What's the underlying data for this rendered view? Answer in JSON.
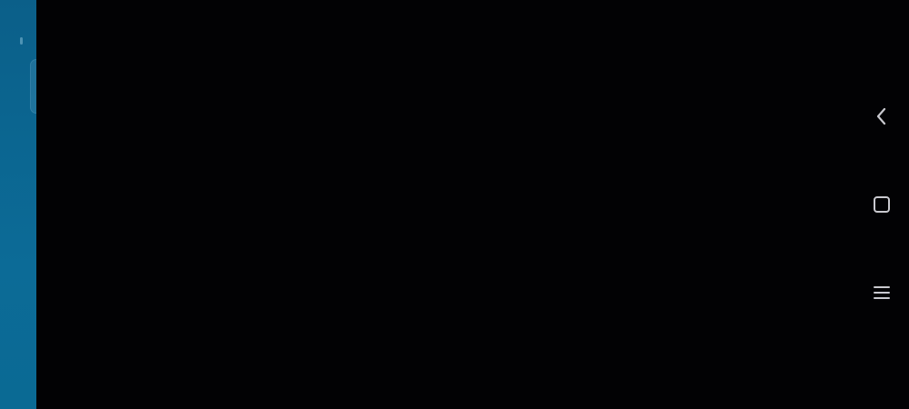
{
  "app": {
    "screen_state": "dark-overlay"
  },
  "colors": {
    "background": "#020204",
    "side_strip": "#0b6691",
    "nav_icon": "#c9c9cf"
  },
  "navigation_bar": {
    "buttons": [
      {
        "id": "back",
        "icon": "back-chevron-icon"
      },
      {
        "id": "home",
        "icon": "home-square-icon"
      },
      {
        "id": "recent",
        "icon": "menu-lines-icon"
      }
    ]
  }
}
